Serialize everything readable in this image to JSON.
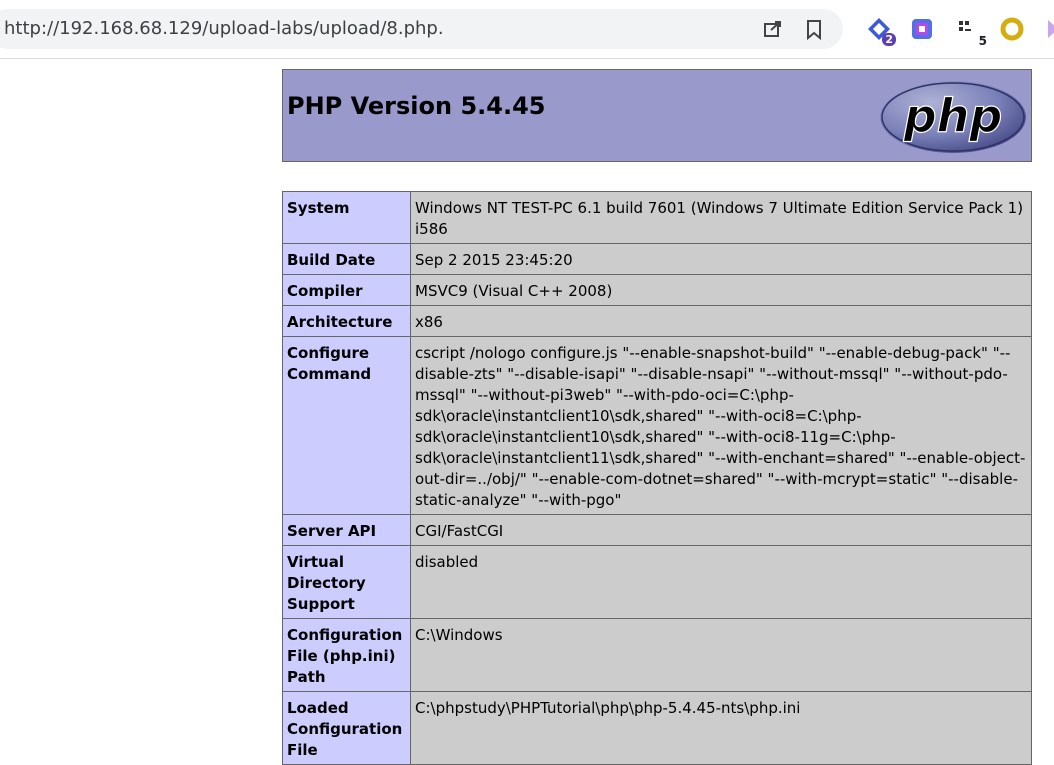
{
  "browser": {
    "url": "http://192.168.68.129/upload-labs/upload/8.php.",
    "extensions": [
      {
        "name": "extension-1",
        "badge": "2"
      },
      {
        "name": "extension-2",
        "badge": ""
      },
      {
        "name": "extension-3",
        "badge": "5"
      },
      {
        "name": "extension-4",
        "badge": ""
      }
    ]
  },
  "page": {
    "title": "PHP Version 5.4.45",
    "logo_text": "php",
    "rows": [
      {
        "key": "System",
        "value": "Windows NT TEST-PC 6.1 build 7601 (Windows 7 Ultimate Edition Service Pack 1) i586"
      },
      {
        "key": "Build Date",
        "value": "Sep 2 2015 23:45:20"
      },
      {
        "key": "Compiler",
        "value": "MSVC9 (Visual C++ 2008)"
      },
      {
        "key": "Architecture",
        "value": "x86"
      },
      {
        "key": "Configure Command",
        "value": "cscript /nologo configure.js \"--enable-snapshot-build\" \"--enable-debug-pack\" \"--disable-zts\" \"--disable-isapi\" \"--disable-nsapi\" \"--without-mssql\" \"--without-pdo-mssql\" \"--without-pi3web\" \"--with-pdo-oci=C:\\php-sdk\\oracle\\instantclient10\\sdk,shared\" \"--with-oci8=C:\\php-sdk\\oracle\\instantclient10\\sdk,shared\" \"--with-oci8-11g=C:\\php-sdk\\oracle\\instantclient11\\sdk,shared\" \"--with-enchant=shared\" \"--enable-object-out-dir=../obj/\" \"--enable-com-dotnet=shared\" \"--with-mcrypt=static\" \"--disable-static-analyze\" \"--with-pgo\""
      },
      {
        "key": "Server API",
        "value": "CGI/FastCGI"
      },
      {
        "key": "Virtual Directory Support",
        "value": "disabled"
      },
      {
        "key": "Configuration File (php.ini) Path",
        "value": "C:\\Windows"
      },
      {
        "key": "Loaded Configuration File",
        "value": "C:\\phpstudy\\PHPTutorial\\php\\php-5.4.45-nts\\php.ini"
      }
    ]
  },
  "colors": {
    "header_bg": "#9999cc",
    "key_bg": "#ccccff",
    "value_bg": "#cccccc"
  }
}
